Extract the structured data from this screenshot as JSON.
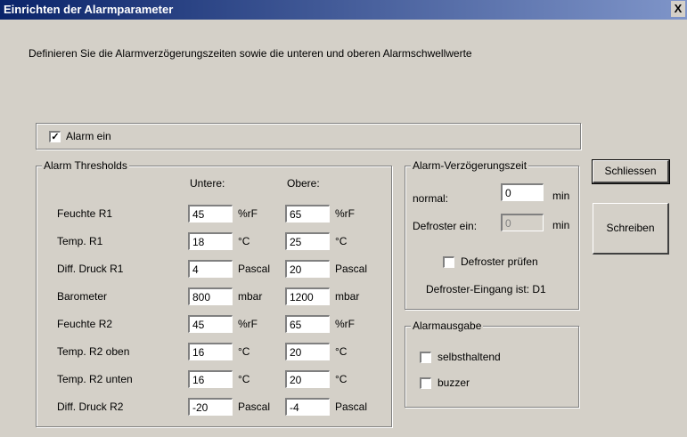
{
  "window": {
    "title": "Einrichten der Alarmparameter",
    "close_glyph": "X"
  },
  "description": "Definieren Sie die Alarmverzögerungszeiten sowie die unteren und oberen Alarmschwellwerte",
  "alarm_ein": {
    "label": "Alarm ein",
    "checked": true
  },
  "thresholds": {
    "legend": "Alarm Thresholds",
    "col_lower": "Untere:",
    "col_upper": "Obere:",
    "rows": [
      {
        "label": "Feuchte R1",
        "lower": "45",
        "lower_unit": "%rF",
        "upper": "65",
        "upper_unit": "%rF"
      },
      {
        "label": "Temp. R1",
        "lower": "18",
        "lower_unit": "°C",
        "upper": "25",
        "upper_unit": "°C"
      },
      {
        "label": "Diff. Druck R1",
        "lower": "4",
        "lower_unit": "Pascal",
        "upper": "20",
        "upper_unit": "Pascal"
      },
      {
        "label": "Barometer",
        "lower": "800",
        "lower_unit": "mbar",
        "upper": "1200",
        "upper_unit": "mbar"
      },
      {
        "label": "Feuchte R2",
        "lower": "45",
        "lower_unit": "%rF",
        "upper": "65",
        "upper_unit": "%rF"
      },
      {
        "label": "Temp. R2 oben",
        "lower": "16",
        "lower_unit": "°C",
        "upper": "20",
        "upper_unit": "°C"
      },
      {
        "label": "Temp. R2 unten",
        "lower": "16",
        "lower_unit": "°C",
        "upper": "20",
        "upper_unit": "°C"
      },
      {
        "label": "Diff. Druck R2",
        "lower": "-20",
        "lower_unit": "Pascal",
        "upper": "-4",
        "upper_unit": "Pascal"
      }
    ]
  },
  "delay": {
    "legend": "Alarm-Verzögerungszeit",
    "normal_label": "normal:",
    "normal_value": "0",
    "normal_unit": "min",
    "defroster_label": "Defroster ein:",
    "defroster_value": "0",
    "defroster_unit": "min",
    "check_label": "Defroster prüfen",
    "check_checked": false,
    "input_text": "Defroster-Eingang ist: D1"
  },
  "output": {
    "legend": "Alarmausgabe",
    "selbsthaltend": {
      "label": "selbsthaltend",
      "checked": false
    },
    "buzzer": {
      "label": "buzzer",
      "checked": false
    }
  },
  "buttons": {
    "close": "Schliessen",
    "write": "Schreiben"
  }
}
